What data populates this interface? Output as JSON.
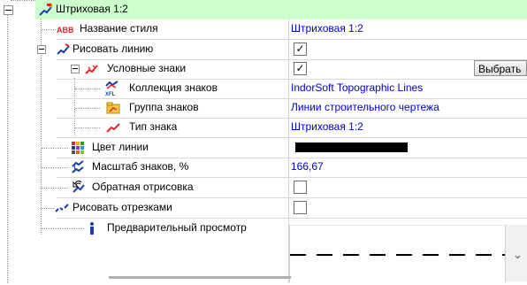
{
  "rows": {
    "header": {
      "label": "Штриховая 1:2"
    },
    "style_name": {
      "label": "Название стиля",
      "value": "Штриховая 1:2"
    },
    "draw_line": {
      "label": "Рисовать линию",
      "checked": "✓"
    },
    "symbols": {
      "label": "Условные знаки",
      "checked": "✓",
      "button": "Выбрать"
    },
    "collection": {
      "label": "Коллекция знаков",
      "value": "IndorSoft Topographic Lines"
    },
    "group": {
      "label": "Группа знаков",
      "value": "Линии строительного чертежа"
    },
    "type": {
      "label": "Тип знака",
      "value": "Штриховая 1:2"
    },
    "line_color": {
      "label": "Цвет линии",
      "color": "#000000"
    },
    "scale": {
      "label": "Масштаб знаков, %",
      "value": "166,67"
    },
    "reverse": {
      "label": "Обратная отрисовка",
      "checked": ""
    },
    "segments": {
      "label": "Рисовать отрезками",
      "checked": ""
    },
    "preview": {
      "label": "Предварительный просмотр"
    }
  },
  "icons": {
    "header": "style-line-icon",
    "style_name": "abc-text-icon",
    "draw_line": "line-draw-icon",
    "symbols": "symbols-line-icon",
    "collection": "xfl-collection-icon",
    "group": "folder-group-icon",
    "type": "symbol-type-icon",
    "line_color": "color-palette-icon",
    "scale": "scale-icon",
    "reverse": "reverse-draw-icon",
    "segments": "segments-icon",
    "preview": "info-icon"
  },
  "colors": {
    "header_bg": "#ccffcc",
    "value_text": "#0000cc",
    "accent_red": "#e8242b"
  }
}
